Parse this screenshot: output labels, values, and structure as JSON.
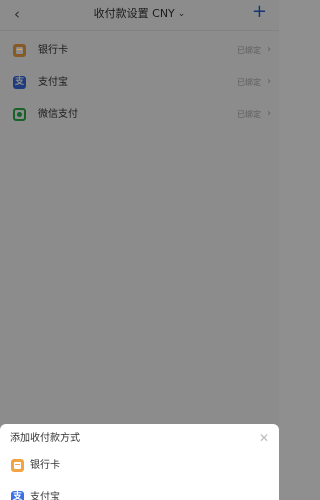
{
  "nav": {
    "back_icon": "chevron-left-icon",
    "title": "收付款设置 CNY",
    "title_dropdown_icon": "chevron-down-icon",
    "add_icon": "plus-icon",
    "accent_color": "#2a61d6"
  },
  "methods": [
    {
      "label": "银行卡",
      "status": "已绑定",
      "icon": "bank-card-icon",
      "color": "#f3a442"
    },
    {
      "label": "支付宝",
      "status": "已绑定",
      "icon": "alipay-icon",
      "color": "#3a6fe6"
    },
    {
      "label": "微信支付",
      "status": "已绑定",
      "icon": "wechat-pay-icon",
      "color": "#2bb24c"
    }
  ],
  "sheet": {
    "title": "添加收付款方式",
    "close_icon": "close-icon",
    "items": [
      {
        "label": "银行卡",
        "icon": "bank-card-icon"
      },
      {
        "label": "支付宝",
        "icon": "alipay-icon"
      }
    ]
  },
  "icons": {
    "alipay_glyph": "支"
  }
}
